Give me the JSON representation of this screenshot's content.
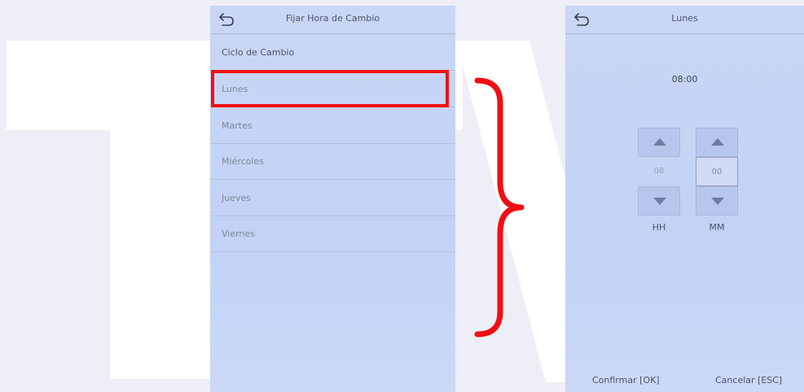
{
  "left_screen": {
    "title": "Fijar Hora de Cambio",
    "items": [
      {
        "label": "Ciclo de Cambio"
      },
      {
        "label": "Lunes"
      },
      {
        "label": "Martes"
      },
      {
        "label": "Miércoles"
      },
      {
        "label": "Jueves"
      },
      {
        "label": "Viernes"
      }
    ]
  },
  "right_screen": {
    "title": "Lunes",
    "time": "08:00",
    "hour": {
      "value": "08",
      "label": "HH"
    },
    "minute": {
      "value": "00",
      "label": "MM"
    },
    "confirm_label": "Confirmar [OK]",
    "cancel_label": "Cancelar [ESC]"
  },
  "colors": {
    "highlight": "#f00e14",
    "screen_bg": "#c5d3f5",
    "watermark": "#ffffff"
  },
  "icons": [
    "back-arrow-icon",
    "arrow-up-icon",
    "arrow-down-icon"
  ]
}
